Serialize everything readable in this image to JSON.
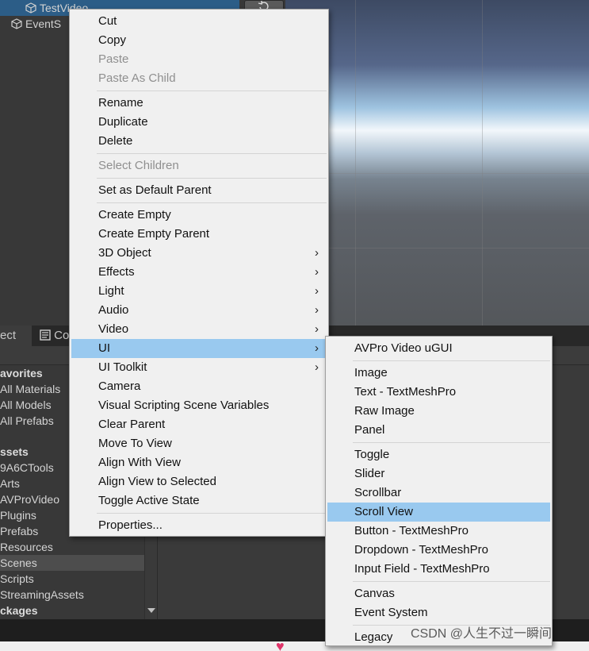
{
  "hierarchy": {
    "items": [
      {
        "label": "TestVideo",
        "selected": true
      },
      {
        "label": "EventS",
        "selected": false
      }
    ],
    "button_icon": "refresh-icon"
  },
  "panel_tabs": {
    "project_tab": "ect",
    "console_tab": "Co"
  },
  "project": {
    "items": [
      {
        "label": "avorites",
        "type": "head"
      },
      {
        "label": "All Materials",
        "type": "item"
      },
      {
        "label": "All Models",
        "type": "item"
      },
      {
        "label": "All Prefabs",
        "type": "item"
      },
      {
        "label": "",
        "type": "spacer"
      },
      {
        "label": "ssets",
        "type": "head"
      },
      {
        "label": "9A6CTools",
        "type": "item"
      },
      {
        "label": "Arts",
        "type": "item"
      },
      {
        "label": "AVProVideo",
        "type": "item"
      },
      {
        "label": "Plugins",
        "type": "item"
      },
      {
        "label": "Prefabs",
        "type": "item"
      },
      {
        "label": "Resources",
        "type": "item"
      },
      {
        "label": "Scenes",
        "type": "selected"
      },
      {
        "label": "Scripts",
        "type": "item"
      },
      {
        "label": "StreamingAssets",
        "type": "item"
      },
      {
        "label": "ckages",
        "type": "head"
      }
    ]
  },
  "context_menu": {
    "items": [
      {
        "label": "Cut",
        "disabled": false
      },
      {
        "label": "Copy",
        "disabled": false
      },
      {
        "label": "Paste",
        "disabled": true
      },
      {
        "label": "Paste As Child",
        "disabled": true
      },
      {
        "separator": true
      },
      {
        "label": "Rename",
        "disabled": false
      },
      {
        "label": "Duplicate",
        "disabled": false
      },
      {
        "label": "Delete",
        "disabled": false
      },
      {
        "separator": true
      },
      {
        "label": "Select Children",
        "disabled": true
      },
      {
        "separator": true
      },
      {
        "label": "Set as Default Parent",
        "disabled": false
      },
      {
        "separator": true
      },
      {
        "label": "Create Empty",
        "disabled": false
      },
      {
        "label": "Create Empty Parent",
        "disabled": false
      },
      {
        "label": "3D Object",
        "submenu": true
      },
      {
        "label": "Effects",
        "submenu": true
      },
      {
        "label": "Light",
        "submenu": true
      },
      {
        "label": "Audio",
        "submenu": true
      },
      {
        "label": "Video",
        "submenu": true
      },
      {
        "label": "UI",
        "submenu": true,
        "highlighted": true
      },
      {
        "label": "UI Toolkit",
        "submenu": true
      },
      {
        "label": "Camera",
        "disabled": false
      },
      {
        "label": "Visual Scripting Scene Variables",
        "disabled": false
      },
      {
        "label": "Clear Parent",
        "disabled": false
      },
      {
        "label": "Move To View",
        "disabled": false
      },
      {
        "label": "Align With View",
        "disabled": false
      },
      {
        "label": "Align View to Selected",
        "disabled": false
      },
      {
        "label": "Toggle Active State",
        "disabled": false
      },
      {
        "separator": true
      },
      {
        "label": "Properties...",
        "disabled": false
      }
    ]
  },
  "ui_submenu": {
    "items": [
      {
        "label": "AVPro Video uGUI"
      },
      {
        "separator": true
      },
      {
        "label": "Image"
      },
      {
        "label": "Text - TextMeshPro"
      },
      {
        "label": "Raw Image"
      },
      {
        "label": "Panel"
      },
      {
        "separator": true
      },
      {
        "label": "Toggle"
      },
      {
        "label": "Slider"
      },
      {
        "label": "Scrollbar"
      },
      {
        "label": "Scroll View",
        "highlighted": true
      },
      {
        "label": "Button - TextMeshPro"
      },
      {
        "label": "Dropdown - TextMeshPro"
      },
      {
        "label": "Input Field - TextMeshPro"
      },
      {
        "separator": true
      },
      {
        "label": "Canvas"
      },
      {
        "label": "Event System"
      },
      {
        "separator": true
      },
      {
        "label": "Legacy"
      }
    ]
  },
  "watermark": "CSDN @人生不过一瞬间",
  "colors": {
    "menu_bg": "#f0f0f0",
    "menu_highlight": "#99c9ef",
    "hierarchy_selection": "#2c5d87"
  }
}
